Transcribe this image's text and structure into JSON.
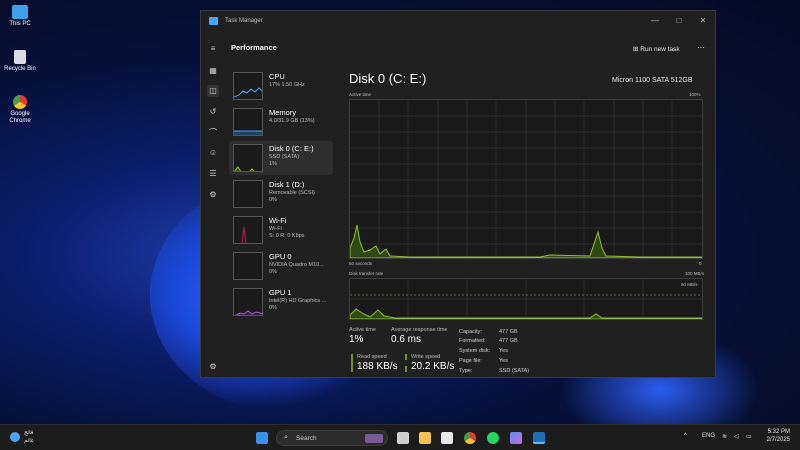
{
  "desktop": {
    "icons": [
      {
        "label": "This PC"
      },
      {
        "label": "Recycle Bin"
      },
      {
        "label": "Google Chrome"
      }
    ]
  },
  "window": {
    "title": "Task Manager",
    "section": "Performance",
    "run_new_task": "Run new task",
    "controls": {
      "minimize": "—",
      "maximize": "□",
      "close": "✕"
    }
  },
  "nav": {
    "icons": [
      "hamburger-icon",
      "processes-icon",
      "performance-icon",
      "app-history-icon",
      "startup-apps-icon",
      "users-icon",
      "details-icon",
      "services-icon",
      "settings-icon"
    ]
  },
  "devices": [
    {
      "name": "CPU",
      "sub1": "17%  1.50 GHz",
      "sub2": ""
    },
    {
      "name": "Memory",
      "sub1": "4.0/31.9 GB (13%)",
      "sub2": ""
    },
    {
      "name": "Disk 0 (C: E:)",
      "sub1": "SSD (SATA)",
      "sub2": "1%"
    },
    {
      "name": "Disk 1 (D:)",
      "sub1": "Removable (SCSI)",
      "sub2": "0%"
    },
    {
      "name": "Wi-Fi",
      "sub1": "Wi-Fi",
      "sub2": "S: 0 R: 0 Kbps"
    },
    {
      "name": "GPU 0",
      "sub1": "NVIDIA Quadro M10...",
      "sub2": "0%"
    },
    {
      "name": "GPU 1",
      "sub1": "Intel(R) HD Graphics ...",
      "sub2": "0%"
    }
  ],
  "detail": {
    "title": "Disk 0 (C: E:)",
    "model": "Micron 1100 SATA 512GB",
    "active_time_label": "Active time",
    "active_time_max": "100%",
    "seconds_label": "60 seconds",
    "zero": "0",
    "transfer_label": "Disk transfer rate",
    "transfer_max": "100 MB/s",
    "transfer_mid": "60 MB/s",
    "stats": {
      "active_time": {
        "label": "Active time",
        "value": "1%"
      },
      "avg_response": {
        "label": "Average response time",
        "value": "0.6 ms"
      },
      "read_speed": {
        "label": "Read speed",
        "value": "188 KB/s"
      },
      "write_speed": {
        "label": "Write speed",
        "value": "20.2 KB/s"
      }
    },
    "props": [
      {
        "k": "Capacity:",
        "v": "477 GB"
      },
      {
        "k": "Formatted:",
        "v": "477 GB"
      },
      {
        "k": "System disk:",
        "v": "Yes"
      },
      {
        "k": "Page file:",
        "v": "Yes"
      },
      {
        "k": "Type:",
        "v": "SSD (SATA)"
      }
    ]
  },
  "taskbar": {
    "weather_top": "فاتح",
    "weather_bottom": "غائم",
    "search_placeholder": "Search",
    "lang": "ENG",
    "time": "5:32 PM",
    "date": "2/7/2025"
  },
  "colors": {
    "disk_graph": "#8fbf3a",
    "wifi_graph": "#c2185b",
    "memory_graph": "#4aa3ff",
    "gpu_graph": "#b04fd9"
  }
}
